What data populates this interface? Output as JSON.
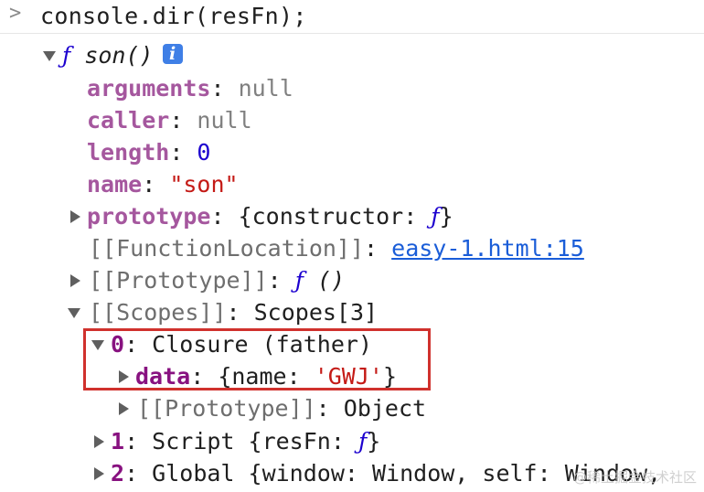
{
  "console": {
    "prompt_symbol": ">",
    "command": "console.dir(resFn);"
  },
  "tree": {
    "root": {
      "f_symbol": "ƒ",
      "name": "son()",
      "info_icon": "i"
    },
    "arguments": {
      "key": "arguments",
      "sep": ": ",
      "value": "null"
    },
    "caller": {
      "key": "caller",
      "sep": ": ",
      "value": "null"
    },
    "length": {
      "key": "length",
      "sep": ": ",
      "value": "0"
    },
    "name": {
      "key": "name",
      "sep": ": ",
      "value": "\"son\""
    },
    "prototype": {
      "key": "prototype",
      "sep": ": ",
      "value_open": "{constructor: ",
      "value_f": "ƒ",
      "value_close": "}"
    },
    "function_location": {
      "key": "[[FunctionLocation]]",
      "sep": ": ",
      "value": "easy-1.html:15"
    },
    "proto": {
      "key": "[[Prototype]]",
      "sep": ": ",
      "value_f": "ƒ",
      "value_rest": " ()"
    },
    "scopes": {
      "key": "[[Scopes]]",
      "sep": ": ",
      "value": "Scopes[3]"
    },
    "scope0": {
      "key": "0",
      "sep": ": ",
      "value": "Closure (father)"
    },
    "scope0_data": {
      "key": "data",
      "sep": ": ",
      "value_open": "{name: ",
      "value_str": "'GWJ'",
      "value_close": "}"
    },
    "scope0_proto": {
      "key": "[[Prototype]]",
      "sep": ": ",
      "value": "Object"
    },
    "scope1": {
      "key": "1",
      "sep": ": ",
      "value_open": "Script {resFn: ",
      "value_f": "ƒ",
      "value_close": "}"
    },
    "scope2": {
      "key": "2",
      "sep": ": ",
      "value": "Global {window: Window, self: Window,"
    }
  },
  "watermark": "@稀土掘金技术社区",
  "colors": {
    "highlight_border": "#d0312d",
    "key_purple": "#a5579e",
    "number_blue": "#1c00cf",
    "string_red": "#c41a16",
    "link_blue": "#1a5dd8"
  }
}
